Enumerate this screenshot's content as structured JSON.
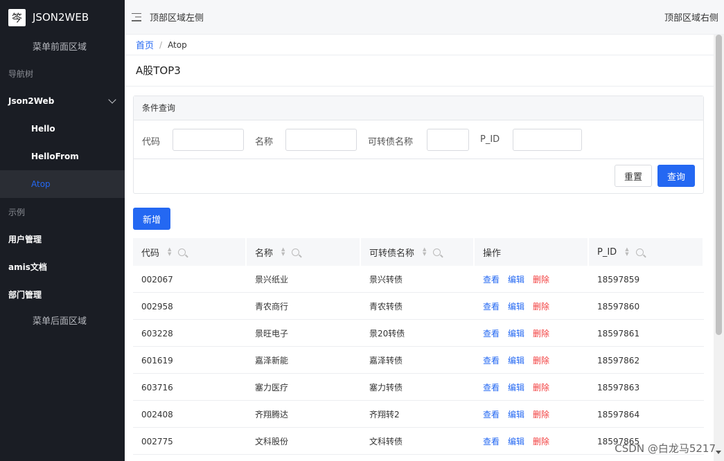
{
  "sidebar": {
    "brand": "JSON2WEB",
    "brand_logo": "笒",
    "menu_before": "菜单前面区域",
    "group_nav": "导航树",
    "json2web": "Json2Web",
    "children": [
      "Hello",
      "HelloFrom",
      "Atop"
    ],
    "group_example": "示例",
    "items": [
      "用户管理",
      "amis文档",
      "部门管理"
    ],
    "menu_after": "菜单后面区域",
    "active_color": "#2468f2"
  },
  "header": {
    "left_text": "顶部区域左侧",
    "right_text": "顶部区域右侧"
  },
  "breadcrumb": {
    "home": "首页",
    "separator": "/",
    "current": "Atop"
  },
  "page": {
    "title": "A股TOP3"
  },
  "filter": {
    "title": "条件查询",
    "labels": [
      "代码",
      "名称",
      "可转债名称",
      "P_ID"
    ],
    "values": [
      "",
      "",
      "",
      ""
    ],
    "reset": "重置",
    "submit": "查询"
  },
  "toolbar": {
    "add": "新增"
  },
  "table": {
    "columns": [
      "代码",
      "名称",
      "可转债名称",
      "操作",
      "P_ID"
    ],
    "ops": [
      "查看",
      "编辑",
      "删除"
    ],
    "rows": [
      [
        "002067",
        "景兴纸业",
        "景兴转债",
        "18597859"
      ],
      [
        "002958",
        "青农商行",
        "青农转债",
        "18597860"
      ],
      [
        "603228",
        "景旺电子",
        "景20转债",
        "18597861"
      ],
      [
        "601619",
        "嘉泽新能",
        "嘉泽转债",
        "18597862"
      ],
      [
        "603716",
        "塞力医疗",
        "塞力转债",
        "18597863"
      ],
      [
        "002408",
        "齐翔腾达",
        "齐翔转2",
        "18597864"
      ],
      [
        "002775",
        "文科股份",
        "文科转债",
        "18597865"
      ]
    ]
  },
  "watermark": "CSDN @白龙马5217"
}
